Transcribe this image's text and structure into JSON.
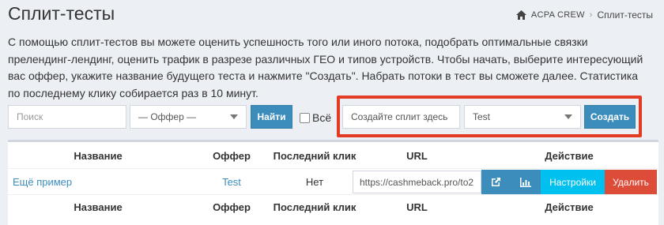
{
  "page": {
    "title": "Сплит-тесты"
  },
  "breadcrumb": {
    "items": [
      "ACPA CREW",
      "Сплит-тесты"
    ]
  },
  "description": "С помощью сплит-тестов вы можете оценить успешность того или иного потока, подобрать оптимальные связки прелендинг-лендинг, оценить трафик в разрезе различных ГЕО и типов устройств. Чтобы начать, выберите интересующий вас оффер, укажите название будущего теста и нажмите \"Создать\". Набрать потоки в тест вы сможете далее. Статистика по последнему клику собирается раз в 10 минут.",
  "filters": {
    "search_placeholder": "Поиск",
    "offer_select": "— Оффер —",
    "find_label": "Найти",
    "all_label": "Всё"
  },
  "create": {
    "name_placeholder": "Создайте сплит здесь",
    "offer_select": "Test",
    "create_label": "Создать"
  },
  "table": {
    "columns": [
      "Название",
      "Оффер",
      "Последний клик",
      "URL",
      "Действие"
    ],
    "rows": [
      {
        "name": "Ещё пример",
        "offer": "Test",
        "last_click": "Нет",
        "url": "https://cashmeback.pro/to2",
        "settings_label": "Настройки",
        "delete_label": "Удалить"
      }
    ]
  },
  "colors": {
    "primary": "#3c8dbc",
    "info": "#00c0ef",
    "danger": "#dd4b39",
    "highlight": "#e23c24"
  },
  "icons": [
    "home-icon",
    "external-link-icon",
    "bar-chart-icon"
  ]
}
